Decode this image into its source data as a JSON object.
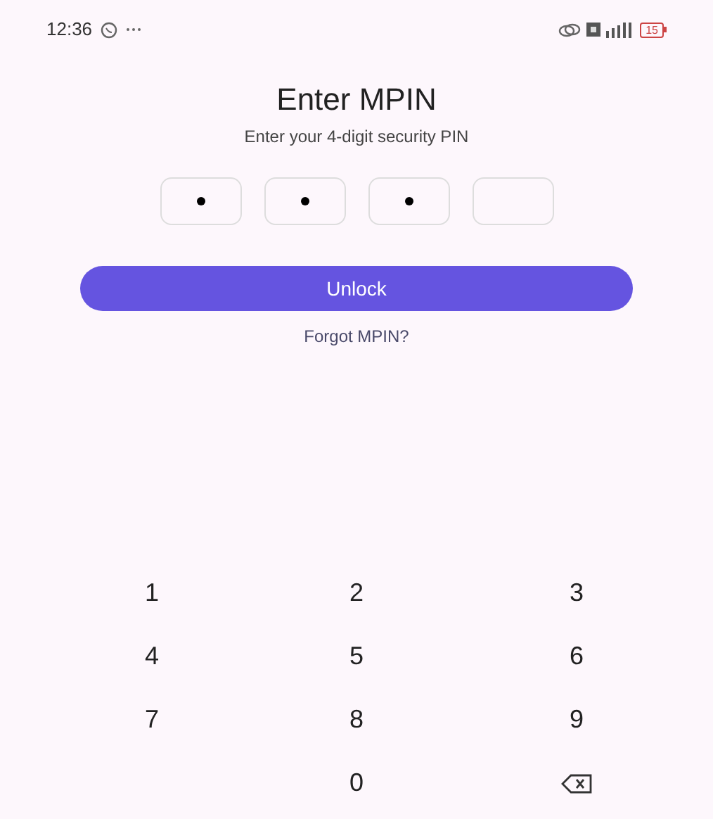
{
  "status_bar": {
    "time": "12:36",
    "battery": "15"
  },
  "title": "Enter MPIN",
  "subtitle": "Enter your 4-digit security PIN",
  "pin_boxes": [
    {
      "filled": true
    },
    {
      "filled": true
    },
    {
      "filled": true
    },
    {
      "filled": false
    }
  ],
  "unlock_button": "Unlock",
  "forgot_link": "Forgot MPIN?",
  "keypad": [
    {
      "kind": "digit",
      "label": "1"
    },
    {
      "kind": "digit",
      "label": "2"
    },
    {
      "kind": "digit",
      "label": "3"
    },
    {
      "kind": "digit",
      "label": "4"
    },
    {
      "kind": "digit",
      "label": "5"
    },
    {
      "kind": "digit",
      "label": "6"
    },
    {
      "kind": "digit",
      "label": "7"
    },
    {
      "kind": "digit",
      "label": "8"
    },
    {
      "kind": "digit",
      "label": "9"
    },
    {
      "kind": "empty"
    },
    {
      "kind": "digit",
      "label": "0"
    },
    {
      "kind": "backspace"
    }
  ]
}
